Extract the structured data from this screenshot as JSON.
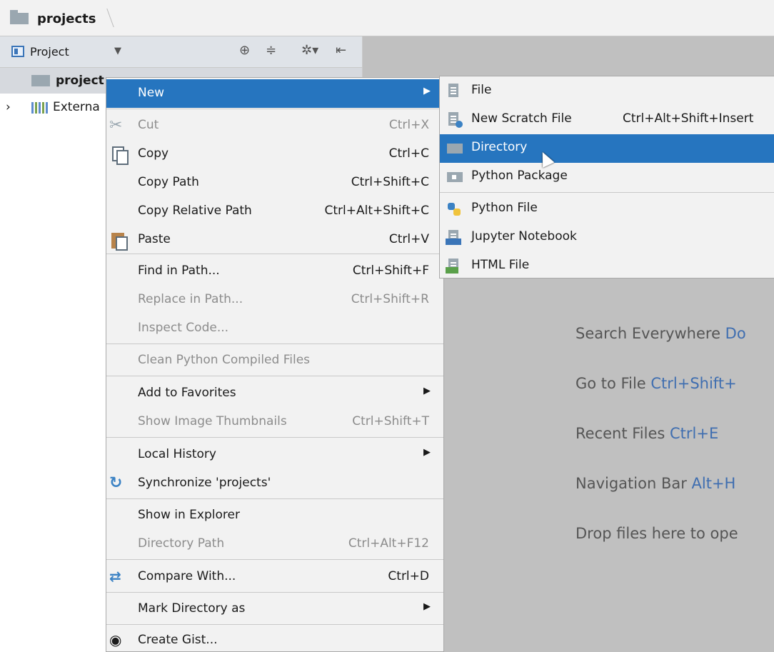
{
  "navbar": {
    "breadcrumb": "projects"
  },
  "project_panel": {
    "header_title": "Project",
    "tree": [
      {
        "label": "project"
      },
      {
        "label": "Externa"
      }
    ]
  },
  "context_menu": {
    "items": [
      {
        "label": "New",
        "shortcut": "",
        "has_submenu": true,
        "selected": true,
        "disabled": false
      },
      {
        "label": "Cut",
        "shortcut": "Ctrl+X",
        "disabled": true
      },
      {
        "label": "Copy",
        "shortcut": "Ctrl+C",
        "disabled": false
      },
      {
        "label": "Copy Path",
        "shortcut": "Ctrl+Shift+C",
        "disabled": false
      },
      {
        "label": "Copy Relative Path",
        "shortcut": "Ctrl+Alt+Shift+C",
        "disabled": false
      },
      {
        "label": "Paste",
        "shortcut": "Ctrl+V",
        "disabled": false
      },
      {
        "label": "Find in Path...",
        "shortcut": "Ctrl+Shift+F",
        "disabled": false
      },
      {
        "label": "Replace in Path...",
        "shortcut": "Ctrl+Shift+R",
        "disabled": true
      },
      {
        "label": "Inspect Code...",
        "shortcut": "",
        "disabled": true
      },
      {
        "label": "Clean Python Compiled Files",
        "shortcut": "",
        "disabled": true
      },
      {
        "label": "Add to Favorites",
        "shortcut": "",
        "has_submenu": true,
        "disabled": false
      },
      {
        "label": "Show Image Thumbnails",
        "shortcut": "Ctrl+Shift+T",
        "disabled": true
      },
      {
        "label": "Local History",
        "shortcut": "",
        "has_submenu": true,
        "disabled": false
      },
      {
        "label": "Synchronize 'projects'",
        "shortcut": "",
        "disabled": false
      },
      {
        "label": "Show in Explorer",
        "shortcut": "",
        "disabled": false
      },
      {
        "label": "Directory Path",
        "shortcut": "Ctrl+Alt+F12",
        "disabled": true
      },
      {
        "label": "Compare With...",
        "shortcut": "Ctrl+D",
        "disabled": false
      },
      {
        "label": "Mark Directory as",
        "shortcut": "",
        "has_submenu": true,
        "disabled": false
      },
      {
        "label": "Create Gist...",
        "shortcut": "",
        "disabled": false
      }
    ]
  },
  "submenu": {
    "items": [
      {
        "label": "File",
        "shortcut": ""
      },
      {
        "label": "New Scratch File",
        "shortcut": "Ctrl+Alt+Shift+Insert"
      },
      {
        "label": "Directory",
        "shortcut": "",
        "selected": true
      },
      {
        "label": "Python Package",
        "shortcut": ""
      },
      {
        "label": "Python File",
        "shortcut": ""
      },
      {
        "label": "Jupyter Notebook",
        "shortcut": ""
      },
      {
        "label": "HTML File",
        "shortcut": ""
      }
    ]
  },
  "editor_hints": [
    {
      "text": "Search Everywhere ",
      "key": "Do"
    },
    {
      "text": "Go to File ",
      "key": "Ctrl+Shift+"
    },
    {
      "text": "Recent Files ",
      "key": "Ctrl+E"
    },
    {
      "text": "Navigation Bar ",
      "key": "Alt+H"
    },
    {
      "text": "Drop files here to ope",
      "key": ""
    }
  ],
  "colors": {
    "selection": "#2675bf",
    "hint_key": "#3f6eb0",
    "editor_bg": "#c0c0c0"
  }
}
